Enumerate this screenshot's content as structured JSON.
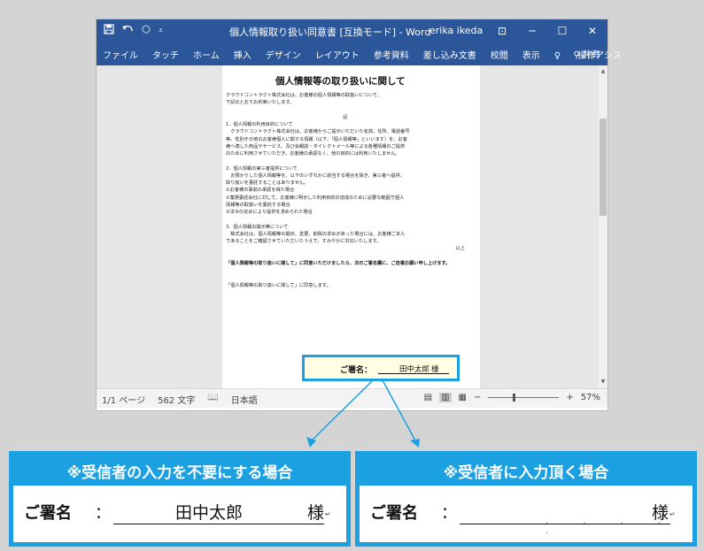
{
  "window": {
    "doc_title": "個人情報取り扱い同意書 [互換モード] - Word",
    "user": "erika ikeda",
    "qat_icons": [
      "save-icon",
      "undo-icon",
      "redo-icon",
      "customize-icon"
    ],
    "controls": [
      "ribbon-display-icon",
      "minimize-icon",
      "maximize-icon",
      "close-icon"
    ],
    "control_glyphs": [
      "⊡",
      "─",
      "☐",
      "✕"
    ]
  },
  "ribbon": {
    "tabs": [
      "ファイル",
      "タッチ",
      "ホーム",
      "挿入",
      "デザイン",
      "レイアウト",
      "参考資料",
      "差し込み文書",
      "校閲",
      "表示"
    ],
    "tell_me": "操作アシス",
    "share": "共有"
  },
  "document": {
    "heading": "個人情報等の取り扱いに関して",
    "lines": [
      "クラウドコントラクト株式会社は、お客様の個人情報等の取扱いについて、",
      "下記のとおりお約束いたします。",
      "",
      "記",
      "1．個人情報の利用目的について",
      "　クラウドコントラクト株式会社は、お客様からご提示いただいた名前、住所、電話番号",
      "等、性別その他のお客様個人に関する情報（以下、「個人情報等」といいます）を、お客",
      "様へ適した商品やサービス、及び会報誌・ダイレクトメール等による各種情報のご提供",
      "のために利用させていただき、お客様の承認なく、他の目的には利用いたしません。",
      "",
      "2．個人情報の第三者提供について",
      "　お預かりした個人情報等を、以下のいずれかに該当する場合を除き、第三者へ提供、",
      "取り扱いを委託することはありません。",
      "①お客様の事前の承認を得た場合",
      "②業務委託会社に対して、お客様に明示した利用目的の達成のために必要な範囲で個人",
      "情報等の取扱いを委託する場合",
      "③法令の定めにより提供を求められた場合",
      "",
      "3．個人情報の開示等について",
      "　株式会社は、個人情報等の開示、変更、削除の求めがあった場合には、お客様ご本人",
      "であることをご確認させていただいたうえで、すみやかに対応いたします。",
      "以上",
      "",
      "「個人情報等の取り扱いに関して」に同意いただけましたら、次のご署名欄に、ご自署お願い申し上げます。",
      "",
      "",
      "「個人情報等の取り扱いに関して」に同意します。"
    ],
    "sig_label": "ご署名：",
    "sig_name": "田中太郎",
    "sig_suffix": "様"
  },
  "status": {
    "page": "1/1 ページ",
    "words": "562 文字",
    "lang": "日本語",
    "zoom": "57%",
    "zoom_minus": "−",
    "zoom_plus": "+"
  },
  "panels": {
    "left_title": "※受信者の入力を不要にする場合",
    "right_title": "※受信者に入力頂く場合",
    "label": "ご署名",
    "colon": "：",
    "left_name": "田中太郎",
    "suffix": "様",
    "para_mark": "↵"
  },
  "colors": {
    "word_blue": "#2b579a",
    "accent": "#1ba1e2",
    "sig_bg": "#fffde2"
  }
}
